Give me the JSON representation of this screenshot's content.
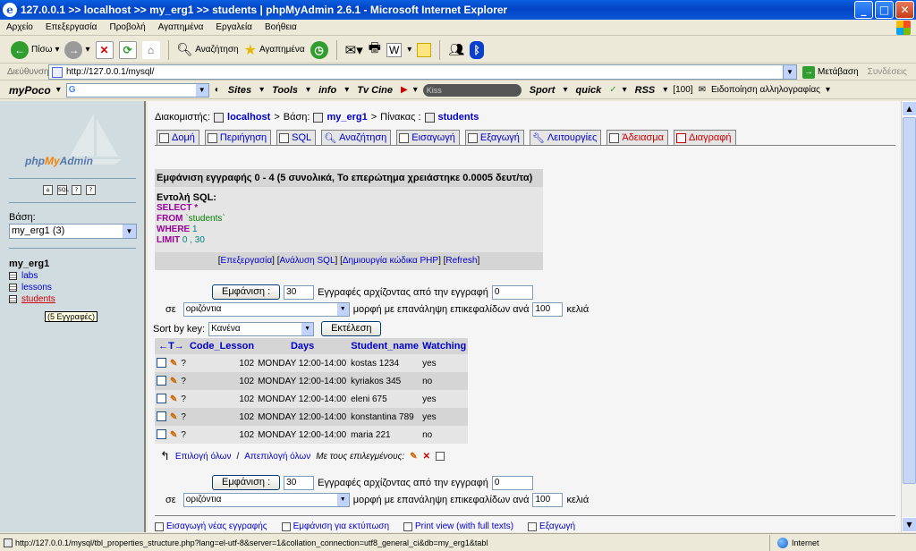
{
  "window": {
    "title": "127.0.0.1 >> localhost >> my_erg1 >> students | phpMyAdmin 2.6.1 - Microsoft Internet Explorer"
  },
  "menu": [
    "Αρχείο",
    "Επεξεργασία",
    "Προβολή",
    "Αγαπημένα",
    "Εργαλεία",
    "Βοήθεια"
  ],
  "toolbar": {
    "back": "Πίσω",
    "search": "Αναζήτηση",
    "favorites": "Αγαπημένα"
  },
  "address": {
    "label": "Διεύθυνση",
    "url": "http://127.0.0.1/mysql/",
    "go": "Μετάβαση",
    "links": "Συνδέσεις"
  },
  "linkbar": {
    "brand": "myPoco",
    "sites": "Sites",
    "tools": "Tools",
    "info": "info",
    "tvcine": "Tv Cine",
    "kiss": "Kiss",
    "sport": "Sport",
    "quick": "quick",
    "rss": "RSS",
    "rss_count": "[100]",
    "mail": "Ειδοποίηση αλληλογραφίας"
  },
  "sidebar": {
    "logo_php": "php",
    "logo_my": "My",
    "logo_admin": "Admin",
    "db_label": "Βάση:",
    "db_selected": "my_erg1 (3)",
    "db_name": "my_erg1",
    "tables": [
      "labs",
      "lessons",
      "students"
    ],
    "tooltip": "(5 Εγγραφές)"
  },
  "breadcrumb": {
    "server_label": "Διακομιστής:",
    "server": "localhost",
    "db_label": "Βάση:",
    "db": "my_erg1",
    "table_label": "Πίνακας :",
    "table": "students"
  },
  "tabs": [
    "Δομή",
    "Περιήγηση",
    "SQL",
    "Αναζήτηση",
    "Εισαγωγή",
    "Εξαγωγή",
    "Λειτουργίες",
    "Άδειασμα",
    "Διαγραφή"
  ],
  "sqlbox": {
    "header": "Εμφάνιση εγγραφής 0 - 4 (5 συνολικά, Το επερώτημα χρειάστηκε 0.0005 δευτ/τα)",
    "label": "Εντολή SQL:",
    "q_select": "SELECT",
    "q_star": "*",
    "q_from": "FROM",
    "q_table": "`students`",
    "q_where": "WHERE",
    "q_where_val": "1",
    "q_limit": "LIMIT",
    "q_limit_val": "0 , 30",
    "link_edit": "Επεξεργασία",
    "link_analyze": "Ανάλυση SQL",
    "link_php": "Δημιουργία κώδικα PHP",
    "link_refresh": "Refresh"
  },
  "nav": {
    "show_btn": "Εμφάνιση :",
    "rows": "30",
    "rows_text": "Εγγραφές αρχίζοντας από την εγγραφή",
    "start": "0",
    "in_label": "σε",
    "mode": "οριζόντια",
    "mode_text": "μορφή με επανάληψη επικεφαλίδων ανά",
    "repeat": "100",
    "cells": "κελιά",
    "sortby": "Sort by key:",
    "sort_value": "Κανένα",
    "execute": "Εκτέλεση"
  },
  "table": {
    "headers": [
      "Code_Lesson",
      "Days",
      "Student_name",
      "Watching"
    ],
    "rows": [
      [
        "102",
        "MONDAY 12:00-14:00",
        "kostas 1234",
        "yes"
      ],
      [
        "102",
        "MONDAY 12:00-14:00",
        "kyriakos 345",
        "no"
      ],
      [
        "102",
        "MONDAY 12:00-14:00",
        "eleni 675",
        "yes"
      ],
      [
        "102",
        "MONDAY 12:00-14:00",
        "konstantina 789",
        "yes"
      ],
      [
        "102",
        "MONDAY 12:00-14:00",
        "maria 221",
        "no"
      ]
    ],
    "select_all": "Επιλογή όλων",
    "slash": "/",
    "deselect_all": "Απεπιλογή όλων",
    "with_selected": "Με τους επιλεγμένους:"
  },
  "bottom": {
    "insert": "Εισαγωγή νέας εγγραφής",
    "print": "Εμφάνιση για εκτύπωση",
    "print_full": "Print view (with full texts)",
    "export": "Εξαγωγή"
  },
  "status": {
    "url": "http://127.0.0.1/mysql/tbl_properties_structure.php?lang=el-utf-8&server=1&collation_connection=utf8_general_ci&db=my_erg1&tabl",
    "zone": "Internet"
  }
}
